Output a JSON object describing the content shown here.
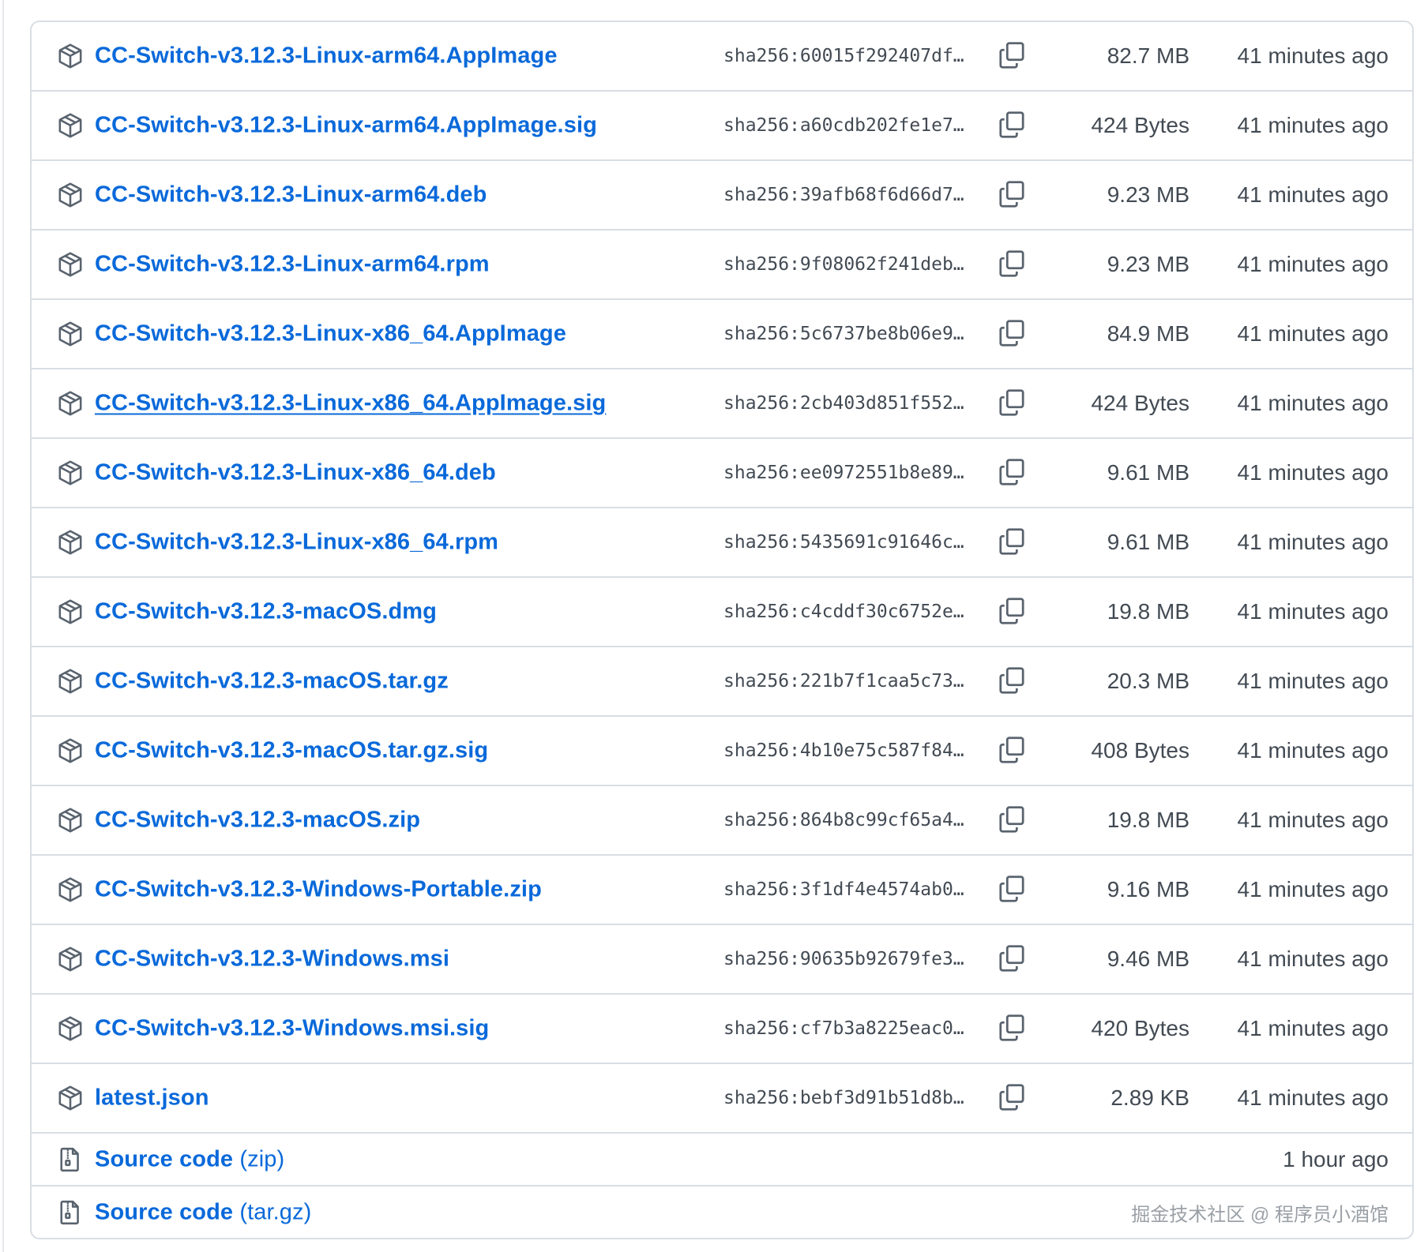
{
  "assets": [
    {
      "name": "CC-Switch-v3.12.3-Linux-arm64.AppImage",
      "digest": "sha256:60015f292407df…",
      "size": "82.7 MB",
      "updated": "41 minutes ago"
    },
    {
      "name": "CC-Switch-v3.12.3-Linux-arm64.AppImage.sig",
      "digest": "sha256:a60cdb202fe1e7…",
      "size": "424 Bytes",
      "updated": "41 minutes ago"
    },
    {
      "name": "CC-Switch-v3.12.3-Linux-arm64.deb",
      "digest": "sha256:39afb68f6d66d7…",
      "size": "9.23 MB",
      "updated": "41 minutes ago"
    },
    {
      "name": "CC-Switch-v3.12.3-Linux-arm64.rpm",
      "digest": "sha256:9f08062f241deb…",
      "size": "9.23 MB",
      "updated": "41 minutes ago"
    },
    {
      "name": "CC-Switch-v3.12.3-Linux-x86_64.AppImage",
      "digest": "sha256:5c6737be8b06e9…",
      "size": "84.9 MB",
      "updated": "41 minutes ago"
    },
    {
      "name": "CC-Switch-v3.12.3-Linux-x86_64.AppImage.sig",
      "digest": "sha256:2cb403d851f552…",
      "size": "424 Bytes",
      "updated": "41 minutes ago"
    },
    {
      "name": "CC-Switch-v3.12.3-Linux-x86_64.deb",
      "digest": "sha256:ee0972551b8e89…",
      "size": "9.61 MB",
      "updated": "41 minutes ago"
    },
    {
      "name": "CC-Switch-v3.12.3-Linux-x86_64.rpm",
      "digest": "sha256:5435691c91646c…",
      "size": "9.61 MB",
      "updated": "41 minutes ago"
    },
    {
      "name": "CC-Switch-v3.12.3-macOS.dmg",
      "digest": "sha256:c4cddf30c6752e…",
      "size": "19.8 MB",
      "updated": "41 minutes ago"
    },
    {
      "name": "CC-Switch-v3.12.3-macOS.tar.gz",
      "digest": "sha256:221b7f1caa5c73…",
      "size": "20.3 MB",
      "updated": "41 minutes ago"
    },
    {
      "name": "CC-Switch-v3.12.3-macOS.tar.gz.sig",
      "digest": "sha256:4b10e75c587f84…",
      "size": "408 Bytes",
      "updated": "41 minutes ago"
    },
    {
      "name": "CC-Switch-v3.12.3-macOS.zip",
      "digest": "sha256:864b8c99cf65a4…",
      "size": "19.8 MB",
      "updated": "41 minutes ago"
    },
    {
      "name": "CC-Switch-v3.12.3-Windows-Portable.zip",
      "digest": "sha256:3f1df4e4574ab0…",
      "size": "9.16 MB",
      "updated": "41 minutes ago"
    },
    {
      "name": "CC-Switch-v3.12.3-Windows.msi",
      "digest": "sha256:90635b92679fe3…",
      "size": "9.46 MB",
      "updated": "41 minutes ago"
    },
    {
      "name": "CC-Switch-v3.12.3-Windows.msi.sig",
      "digest": "sha256:cf7b3a8225eac0…",
      "size": "420 Bytes",
      "updated": "41 minutes ago"
    },
    {
      "name": "latest.json",
      "digest": "sha256:bebf3d91b51d8b…",
      "size": "2.89 KB",
      "updated": "41 minutes ago"
    }
  ],
  "source_code": [
    {
      "label": "Source code",
      "format": "(zip)",
      "updated": "1 hour ago"
    },
    {
      "label": "Source code",
      "format": "(tar.gz)",
      "updated": ""
    }
  ],
  "watermark": "掘金技术社区 @ 程序员小酒馆",
  "icons": {
    "asset": "package-icon",
    "source": "file-zip-icon",
    "copy": "copy-icon"
  },
  "colors": {
    "link": "#0969da",
    "muted_text": "#424a53",
    "border": "#d8dee4",
    "icon": "#59636e"
  }
}
